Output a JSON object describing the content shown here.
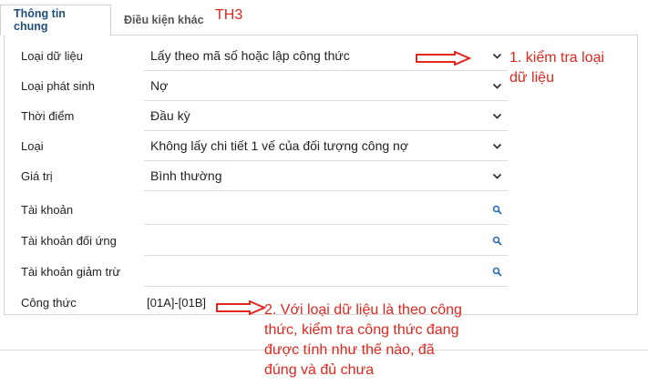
{
  "tabs": [
    {
      "label": "Thông tin chung"
    },
    {
      "label": "Điều kiện khác"
    }
  ],
  "case_tag": "TH3",
  "fields": [
    {
      "label": "Loại dữ liệu",
      "value": "Lấy theo mã số hoặc lập công thức",
      "control": "dropdown"
    },
    {
      "label": "Loại phát sinh",
      "value": "Nợ",
      "control": "dropdown"
    },
    {
      "label": "Thời điểm",
      "value": "Đầu kỳ",
      "control": "dropdown"
    },
    {
      "label": "Loại",
      "value": "Không lấy chi tiết 1 vế của đối tượng công nợ",
      "control": "dropdown"
    },
    {
      "label": "Giá trị",
      "value": "Bình thường",
      "control": "dropdown"
    },
    {
      "label": "Tài khoản",
      "value": "",
      "control": "lookup"
    },
    {
      "label": "Tài khoản đối ứng",
      "value": "",
      "control": "lookup"
    },
    {
      "label": "Tài khoản giảm trừ",
      "value": "",
      "control": "lookup"
    }
  ],
  "formula": {
    "label": "Công thức",
    "value": "[01A]-[01B]"
  },
  "annotations": {
    "note1_line1": "1. kiểm tra loại",
    "note1_line2": "dữ liệu",
    "note2_line1": "2. Với loại dữ liệu là theo công",
    "note2_line2": "thức, kiểm tra công thức đang",
    "note2_line3": "được tính như thế nào, đã",
    "note2_line4": "đúng và đủ chưa"
  },
  "colors": {
    "annotation": "#e0261d",
    "active_tab_text": "#1f4e79"
  }
}
